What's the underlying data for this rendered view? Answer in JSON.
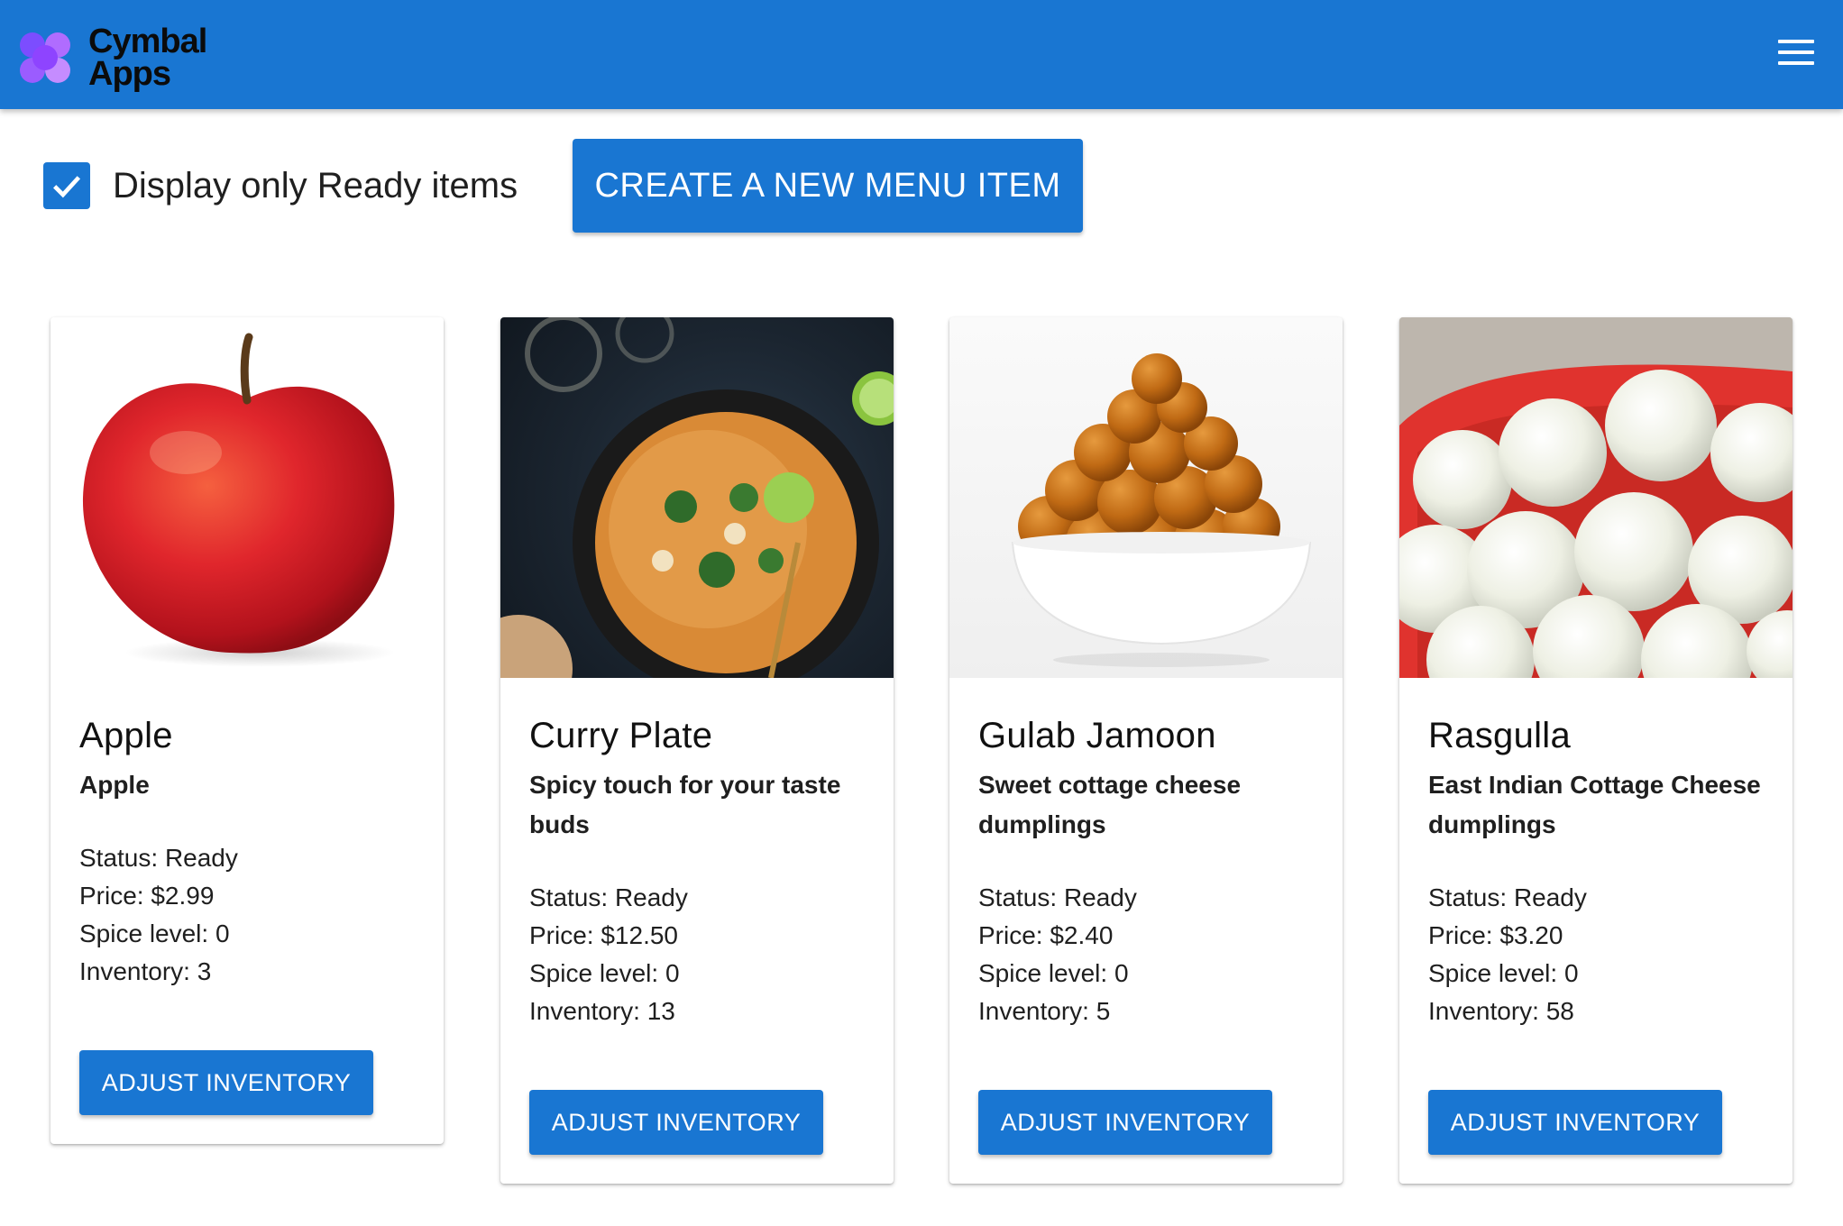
{
  "app": {
    "logo_line1": "Cymbal",
    "logo_line2": "Apps"
  },
  "filter": {
    "checkbox_label": "Display only Ready items",
    "checked": true
  },
  "actions": {
    "create_label": "CREATE A NEW MENU ITEM"
  },
  "colors": {
    "primary": "#1976d2",
    "text": "#1f1f1f"
  },
  "items": [
    {
      "name": "Apple",
      "description": "Apple",
      "status": "Status: Ready",
      "price": "Price: $2.99",
      "spice": "Spice level: 0",
      "inventory": "Inventory: 3",
      "button": "ADJUST INVENTORY"
    },
    {
      "name": "Curry Plate",
      "description": "Spicy touch for your taste buds",
      "status": "Status: Ready",
      "price": "Price: $12.50",
      "spice": "Spice level: 0",
      "inventory": "Inventory: 13",
      "button": "ADJUST INVENTORY"
    },
    {
      "name": "Gulab Jamoon",
      "description": "Sweet cottage cheese dumplings",
      "status": "Status: Ready",
      "price": "Price: $2.40",
      "spice": "Spice level: 0",
      "inventory": "Inventory: 5",
      "button": "ADJUST INVENTORY"
    },
    {
      "name": "Rasgulla",
      "description": "East Indian Cottage Cheese dumplings",
      "status": "Status: Ready",
      "price": "Price: $3.20",
      "spice": "Spice level: 0",
      "inventory": "Inventory: 58",
      "button": "ADJUST INVENTORY"
    }
  ]
}
